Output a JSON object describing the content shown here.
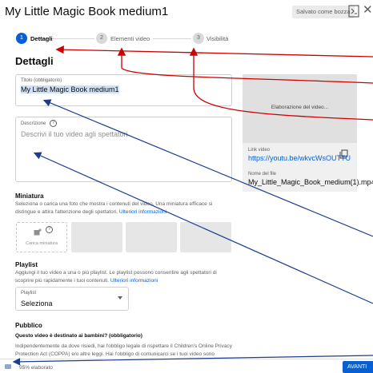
{
  "header": {
    "title": "My Little Magic Book medium1",
    "saved_label": "Salvato come bozza",
    "close_glyph": "✕"
  },
  "stepper": {
    "steps": [
      {
        "number": "1",
        "label": "Dettagli"
      },
      {
        "number": "2",
        "label": "Elementi video"
      },
      {
        "number": "3",
        "label": "Visibilità"
      }
    ]
  },
  "details": {
    "section_title": "Dettagli",
    "title_field": {
      "label": "Titolo (obbligatorio)",
      "value": "My Little Magic Book medium1"
    },
    "description_field": {
      "label": "Descrizione",
      "help": "?",
      "placeholder": "Descrivi il tuo video agli spettatori"
    }
  },
  "preview": {
    "processing_text": "Elaborazione del video...",
    "link_label": "Link video",
    "link": "https://youtu.be/wkvcWsOUTTU",
    "file_label": "Nome del file",
    "file_name": "My_Little_Magic_Book_medium(1).mp4"
  },
  "thumbnail": {
    "title": "Miniatura",
    "desc_line1": "Seleziona o carica una foto che mostra i contenuti del video. Una miniatura efficace si",
    "desc_line2": "distingue e attira l'attenzione degli spettatori.",
    "more_link": "Ulteriori informazioni",
    "upload_label": "Carica miniatura",
    "help": "?"
  },
  "playlist": {
    "title": "Playlist",
    "desc_line1": "Aggiungi il tuo video a una o più playlist. Le playlist possono consentire agli spettatori di",
    "desc_line2": "scoprire più rapidamente i tuoi contenuti.",
    "more_link": "Ulteriori informazioni",
    "select_label": "Playlist",
    "select_value": "Seleziona"
  },
  "audience": {
    "title": "Pubblico",
    "question": "Questo video è destinato ai bambini? (obbligatorio)",
    "line1": "Indipendentemente da dove risiedi, hai l'obbligo legale di rispettare il Children's Online Privacy",
    "line2": "Protection Act (COPPA) e/o altre leggi. Hai l'obbligo di comunicarci se i tuoi video sono"
  },
  "footer": {
    "status": "95% elaborato",
    "next_label": "AVANTI"
  },
  "colors": {
    "accent": "#065fd4",
    "annotation": "#cc0000"
  }
}
